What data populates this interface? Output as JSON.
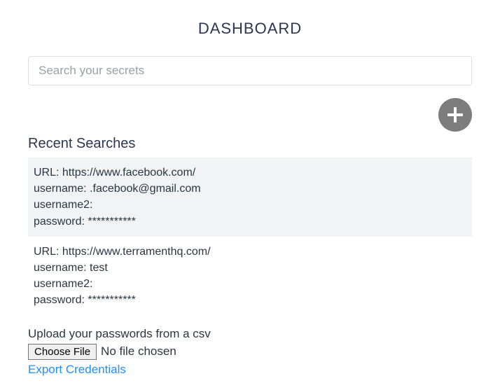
{
  "title": "DASHBOARD",
  "search": {
    "placeholder": "Search your secrets",
    "value": ""
  },
  "section_title": "Recent Searches",
  "labels": {
    "url": "URL: ",
    "username": "username: ",
    "username2": "username2: ",
    "password": "password: "
  },
  "entries": [
    {
      "url": "https://www.facebook.com/",
      "username": ".facebook@gmail.com",
      "username2": "",
      "password": "***********"
    },
    {
      "url": "https://www.terramenthq.com/",
      "username": "test",
      "username2": "",
      "password": "***********"
    }
  ],
  "upload": {
    "label": "Upload your passwords from a csv",
    "button": "Choose File",
    "status": "No file chosen"
  },
  "export_link": "Export Credentials"
}
